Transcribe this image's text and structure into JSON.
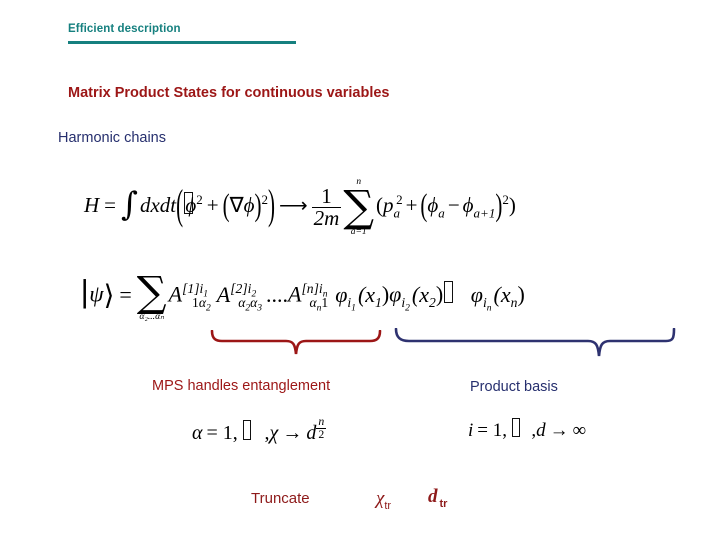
{
  "header": {
    "title": "Efficient description",
    "rule_color": "#16807f"
  },
  "slide": {
    "title": "Matrix Product States for continuous variables",
    "title_color": "#9c1616",
    "subtitle": "Harmonic chains",
    "subtitle_color": "#262f6e"
  },
  "equations": {
    "hamiltonian": {
      "lhs": "H",
      "eq": "=",
      "integral": "∫",
      "measure": "dxdt",
      "open_paren": "(",
      "term1_base": "ϕ",
      "term1_exp": "2",
      "plus": "+",
      "grad": "∇",
      "grad_field": "ϕ",
      "term2_exp": "2",
      "close_paren": ")",
      "arrow": "⟶",
      "frac_num": "1",
      "frac_den": "2m",
      "sum_upper": "n",
      "sum_symbol": "∑",
      "sum_lower": "a=1",
      "rhs_open": "(",
      "p_base": "p",
      "p_sub": "a",
      "p_exp": "2",
      "rhs_plus": "+",
      "phi_a": "ϕ",
      "phi_a_sub": "a",
      "minus": "−",
      "phi_a1": "ϕ",
      "phi_a1_sub": "a+1",
      "rhs_exp": "2",
      "rhs_close": ")"
    },
    "mps": {
      "ket_open": "∣",
      "psi": "ψ",
      "ket_close": "⟩",
      "eq": "=",
      "sum_symbol": "∑",
      "sum_lower": "α₂...αₙ",
      "A1": "A",
      "A1_sup": "[1]i",
      "A1_sup_sub": "1",
      "A1_sub_left": "1",
      "A1_sub_right": "α",
      "A1_sub_right_sub": "2",
      "A2": "A",
      "A2_sup": "[2]i",
      "A2_sup_sub": "2",
      "A2_sub_l": "α",
      "A2_sub_l_sub": "2",
      "A2_sub_r": "α",
      "A2_sub_r_sub": "3",
      "dots": "....",
      "An": "A",
      "An_sup": "[n]i",
      "An_sup_sub": "n",
      "An_sub_l": "α",
      "An_sub_l_sub": "n",
      "An_sub_r": "1",
      "phi1": "φ",
      "phi1_sub": "i",
      "phi1_sub_sub": "1",
      "phi1_arg": "(x",
      "phi1_arg_sub": "1",
      "phi1_arg_close": ")",
      "phi2": "φ",
      "phi2_sub": "i",
      "phi2_sub_sub": "2",
      "phi2_arg": "(x",
      "phi2_arg_sub": "2",
      "phi2_arg_close": ")",
      "ellipsis_glyph": "missing-glyph-box",
      "phin": "φ",
      "phin_sub": "i",
      "phin_sub_sub": "n",
      "phin_arg": "(x",
      "phin_arg_sub": "n",
      "phin_arg_close": ")"
    },
    "alpha": {
      "alpha": "α",
      "eq": "= 1,",
      "missing": "missing-glyph-box",
      "comma": ",",
      "chi": "χ",
      "arrow": "→",
      "d": "d",
      "exp_num": "n",
      "exp_den": "2"
    },
    "index": {
      "i": "i",
      "eq": "= 1,",
      "missing": "missing-glyph-box",
      "comma": ",",
      "d": "d",
      "arrow": "→",
      "infinity": "∞"
    }
  },
  "annotations": {
    "brace_mps_label": "MPS handles entanglement",
    "brace_mps_color": "#9c1616",
    "brace_basis_label": "Product basis",
    "brace_basis_color": "#2e3270"
  },
  "truncate": {
    "label": "Truncate",
    "chi_symbol": "χ",
    "chi_sub": "tr",
    "d_symbol": "d",
    "d_sub": "tr",
    "color": "#8e1a1a"
  }
}
